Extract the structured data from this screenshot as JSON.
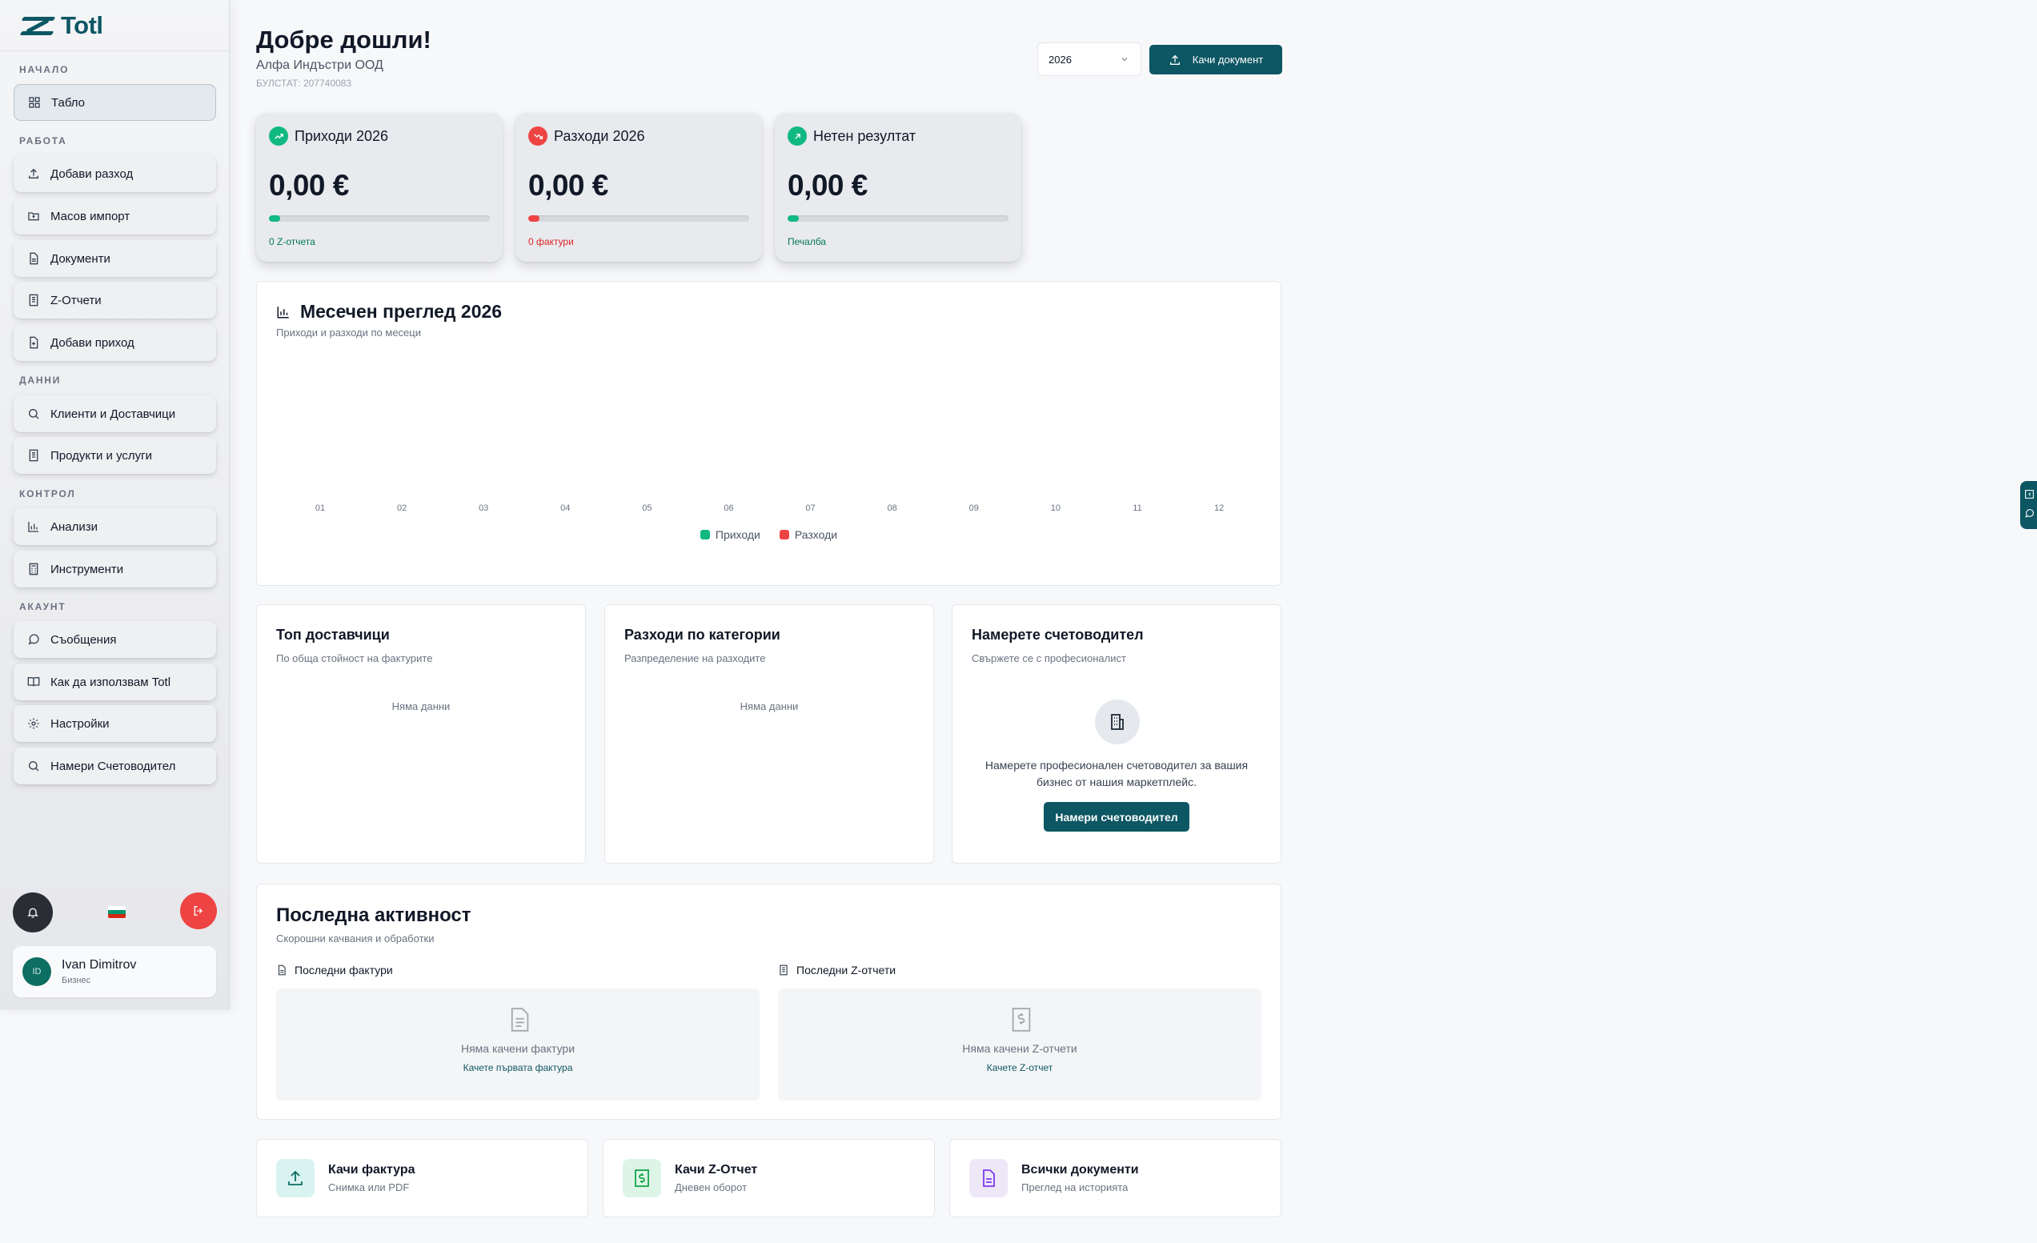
{
  "app": {
    "logo_text": "Totl"
  },
  "sidebar": {
    "sections": {
      "start": "НАЧАЛО",
      "work": "РАБОТА",
      "data": "ДАННИ",
      "control": "КОНТРОЛ",
      "account": "АКАУНТ"
    },
    "items": [
      {
        "label": "Табло",
        "icon": "dashboard-icon"
      },
      {
        "label": "Добави разход",
        "icon": "upload-icon"
      },
      {
        "label": "Масов импорт",
        "icon": "folder-icon"
      },
      {
        "label": "Документи",
        "icon": "document-icon"
      },
      {
        "label": "Z-Отчети",
        "icon": "receipt-icon"
      },
      {
        "label": "Добави приход",
        "icon": "document-plus-icon"
      },
      {
        "label": "Клиенти и Доставчици",
        "icon": "search-icon"
      },
      {
        "label": "Продукти и услуги",
        "icon": "receipt-icon"
      },
      {
        "label": "Анализи",
        "icon": "bar-chart-icon"
      },
      {
        "label": "Инструменти",
        "icon": "calculator-icon"
      },
      {
        "label": "Съобщения",
        "icon": "message-icon"
      },
      {
        "label": "Как да използвам Totl",
        "icon": "book-icon"
      },
      {
        "label": "Настройки",
        "icon": "gear-icon"
      },
      {
        "label": "Намери Счетоводител",
        "icon": "search-icon"
      }
    ],
    "user": {
      "initials": "ID",
      "name": "Ivan Dimitrov",
      "role": "Бизнес"
    },
    "flag_colors": [
      "#ffffff",
      "#00966e",
      "#d62612"
    ]
  },
  "header": {
    "title": "Добре дошли!",
    "company": "Алфа Индъстри ООД",
    "bulstat": "БУЛСТАТ: 207740083",
    "year": "2026",
    "upload_button": "Качи документ"
  },
  "stats": [
    {
      "title": "Приходи 2026",
      "value": "0,00 €",
      "sub": "0 Z-отчета",
      "progress": 0.05,
      "color": "#10b981",
      "icon": "trend-up-icon"
    },
    {
      "title": "Разходи 2026",
      "value": "0,00 €",
      "sub": "0 фактури",
      "progress": 0.05,
      "color": "#ef4444",
      "icon": "trend-down-icon"
    },
    {
      "title": "Нетен резултат",
      "value": "0,00 €",
      "sub": "Печалба",
      "progress": 0.05,
      "color": "#10b981",
      "icon": "arrow-up-right-icon"
    }
  ],
  "monthly": {
    "title": "Месечен преглед 2026",
    "subtitle": "Приходи и разходи по месеци"
  },
  "chart_data": {
    "type": "bar",
    "categories": [
      "01",
      "02",
      "03",
      "04",
      "05",
      "06",
      "07",
      "08",
      "09",
      "10",
      "11",
      "12"
    ],
    "series": [
      {
        "name": "Приходи",
        "color": "#10b981",
        "values": [
          0,
          0,
          0,
          0,
          0,
          0,
          0,
          0,
          0,
          0,
          0,
          0
        ]
      },
      {
        "name": "Разходи",
        "color": "#ef4444",
        "values": [
          0,
          0,
          0,
          0,
          0,
          0,
          0,
          0,
          0,
          0,
          0,
          0
        ]
      }
    ],
    "title": "Месечен преглед 2026",
    "grid": false,
    "legend": "bottom-center"
  },
  "suppliers": {
    "title": "Топ доставчици",
    "subtitle": "По обща стойност на фактурите",
    "empty": "Няма данни"
  },
  "categories": {
    "title": "Разходи по категории",
    "subtitle": "Разпределение на разходите",
    "empty": "Няма данни"
  },
  "accountant": {
    "title": "Намерете счетоводител",
    "subtitle": "Свържете се с професионалист",
    "text": "Намерете професионален счетоводител за вашия бизнес от нашия маркетплейс.",
    "button": "Намери счетоводител"
  },
  "activity": {
    "title": "Последна активност",
    "subtitle": "Скорошни качвания и обработки",
    "invoices": {
      "heading": "Последни фактури",
      "empty": "Няма качени фактури",
      "link": "Качете първата фактура"
    },
    "zreports": {
      "heading": "Последни Z-отчети",
      "empty": "Няма качени Z-отчети",
      "link": "Качете Z-отчет"
    }
  },
  "quick_actions": [
    {
      "title": "Качи фактура",
      "subtitle": "Снимка или PDF",
      "icon": "upload-icon",
      "bg": "#d9f3f1",
      "color": "#0d6e62"
    },
    {
      "title": "Качи Z-Отчет",
      "subtitle": "Дневен оборот",
      "icon": "receipt-dollar-icon",
      "bg": "#dcf5e7",
      "color": "#16a34a"
    },
    {
      "title": "Всички документи",
      "subtitle": "Преглед на историята",
      "icon": "document-icon",
      "bg": "#ede7f7",
      "color": "#7c3aed"
    }
  ]
}
